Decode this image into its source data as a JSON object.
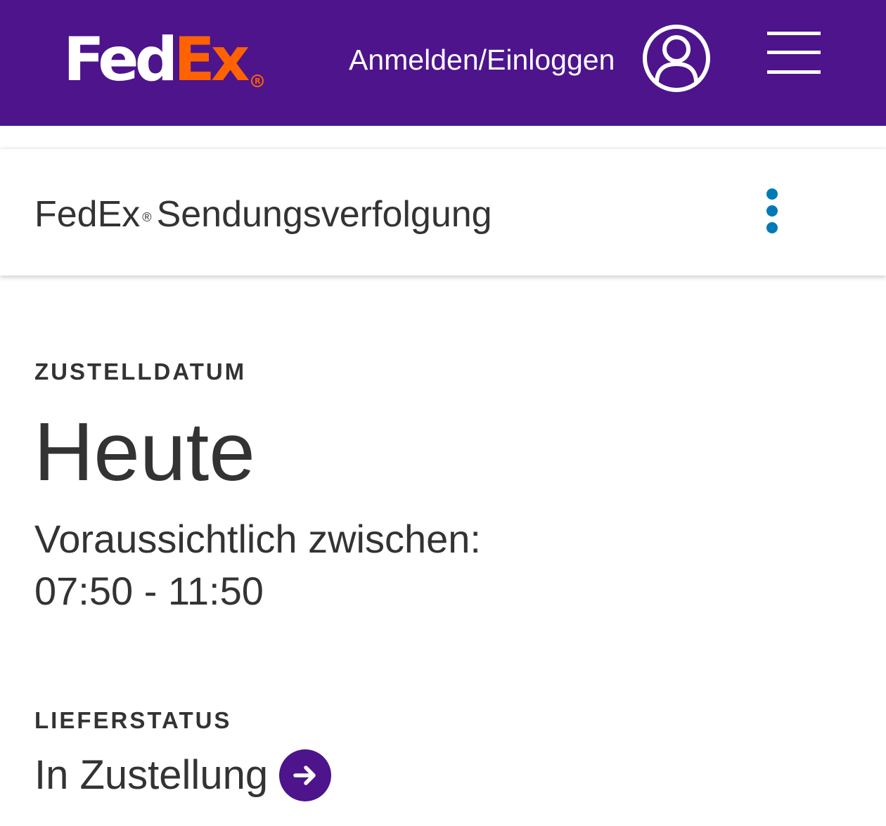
{
  "header": {
    "logo": {
      "fed": "Fed",
      "ex": "Ex",
      "reg": "R"
    },
    "login_label": "Anmelden/Einloggen",
    "user_icon": "user-circle-icon",
    "menu_icon": "hamburger-menu-icon"
  },
  "title_card": {
    "title_brand": "FedEx",
    "title_reg": "®",
    "title_rest": "Sendungsverfolgung",
    "more_icon": "kebab-menu-icon"
  },
  "delivery": {
    "date_label": "ZUSTELLDATUM",
    "date_value": "Heute",
    "estimate_label": "Voraussichtlich zwischen:",
    "time_window": "07:50 - 11:50"
  },
  "status": {
    "label": "LIEFERSTATUS",
    "value": "In Zustellung",
    "arrow_icon": "arrow-right-circle-icon"
  },
  "colors": {
    "brand_purple": "#4d148c",
    "brand_orange": "#ff6200",
    "accent_blue": "#007ab7",
    "text": "#333333"
  }
}
